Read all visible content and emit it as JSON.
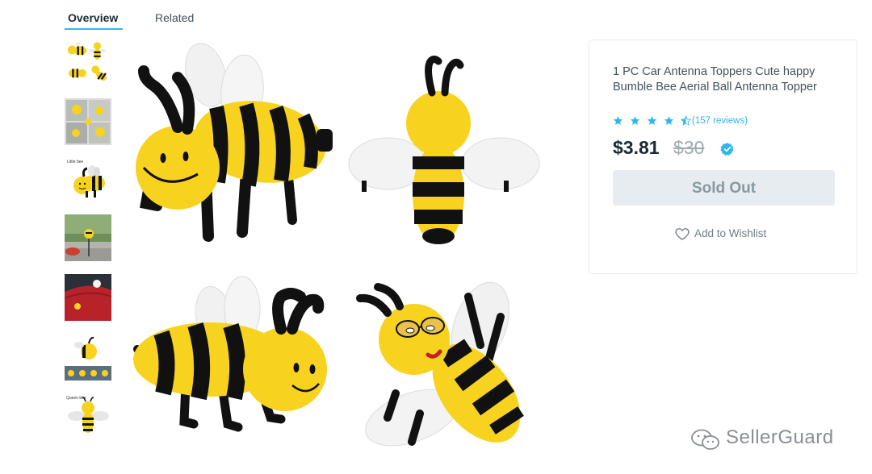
{
  "tabs": [
    {
      "label": "Overview",
      "active": true
    },
    {
      "label": "Related",
      "active": false
    }
  ],
  "thumbnails": {
    "count": 7,
    "captions": {
      "thumb3": "Little bee",
      "thumb7": "Queen bee"
    }
  },
  "product": {
    "title": "1 PC Car Antenna Toppers Cute happy Bumble Bee Aerial Ball Antenna Topper",
    "rating": 4.5,
    "reviews_text": "(157 reviews)",
    "price": "$3.81",
    "original_price": "$30",
    "sold_out_label": "Sold Out",
    "wishlist_label": "Add to Wishlist"
  },
  "watermark": {
    "text": "SellerGuard"
  },
  "colors": {
    "accent_blue": "#2fb7ec",
    "star": "#2fb7ec",
    "bee_yellow": "#f7d21f",
    "bee_black": "#111111",
    "sold_out_bg": "#e6ecef",
    "sold_out_text": "#8898a1"
  }
}
